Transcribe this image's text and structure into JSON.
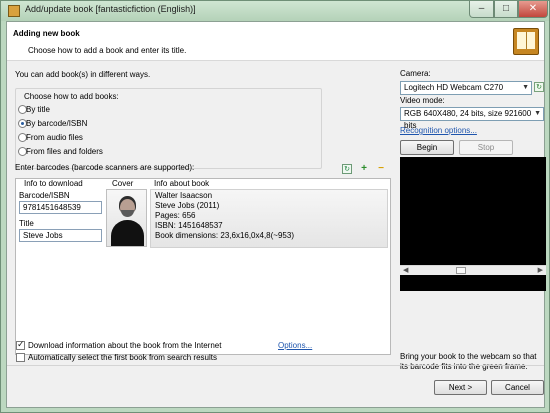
{
  "window": {
    "title": "Add/update book [fantasticfiction (English)]",
    "minimize_glyph": "‒",
    "maximize_glyph": "□",
    "close_glyph": "✕"
  },
  "header": {
    "title": "Adding new book",
    "subtitle": "Choose how to add a book and enter its title.",
    "icon": "book-icon"
  },
  "left": {
    "intro": "You can add book(s) in different ways.",
    "choose_label": "Choose how to add books:",
    "options": [
      {
        "label": "By title",
        "checked": false
      },
      {
        "label": "By barcode/ISBN",
        "checked": true
      },
      {
        "label": "From audio files",
        "checked": false
      },
      {
        "label": "From files and folders",
        "checked": false
      }
    ],
    "barcode_label": "Enter barcodes (barcode scanners are supported):",
    "columns": {
      "info": "Info to download",
      "cover": "Cover",
      "about": "Info about book"
    },
    "row": {
      "barcode_label": "Barcode/ISBN",
      "barcode_value": "9781451648539",
      "title_label": "Title",
      "title_value": "Steve Jobs",
      "info": [
        "Walter Isaacson",
        "Steve Jobs (2011)",
        "Pages: 656",
        "ISBN: 1451648537",
        "Book dimensions: 23,6x16,0x4,8(~953)"
      ]
    },
    "download": {
      "label": "Download information about the book from the Internet",
      "checked": true
    },
    "options_link": "Options...",
    "auto_select": {
      "label": "Automatically select the first book from search results",
      "checked": false
    }
  },
  "right": {
    "camera_label": "Camera:",
    "camera_value": "Logitech HD Webcam C270",
    "video_mode_label": "Video mode:",
    "video_mode_value": "RGB 640X480, 24 bits, size 921600 bits",
    "recognition_link": "Recognition options...",
    "begin": "Begin",
    "stop": "Stop",
    "help": "Bring your book to the webcam so that its barcode fits into the green frame."
  },
  "footer": {
    "next": "Next >",
    "cancel": "Cancel"
  },
  "icons": {
    "sync": "sync-icon",
    "add": "plus-icon",
    "remove": "minus-icon",
    "camera_refresh": "refresh-icon"
  }
}
